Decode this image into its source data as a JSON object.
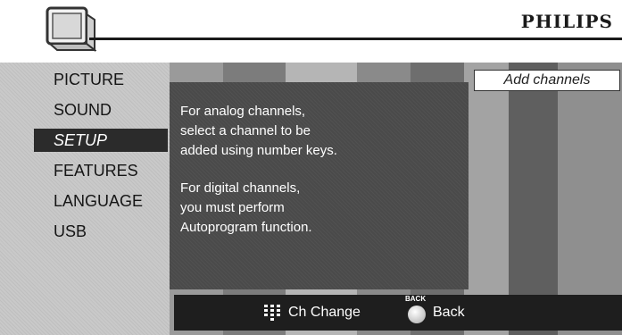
{
  "header": {
    "brand": "PHILIPS",
    "tv_icon": "tv-icon"
  },
  "menu": {
    "items": [
      {
        "label": "PICTURE",
        "selected": false
      },
      {
        "label": "SOUND",
        "selected": false
      },
      {
        "label": "SETUP",
        "selected": true
      },
      {
        "label": "FEATURES",
        "selected": false
      },
      {
        "label": "LANGUAGE",
        "selected": false
      },
      {
        "label": "USB",
        "selected": false
      }
    ]
  },
  "panel": {
    "title": "Add channels",
    "analog_lines": [
      "For analog channels,",
      "select a channel to be",
      "added using number keys."
    ],
    "digital_lines": [
      "For digital channels,",
      "you must perform",
      "Autoprogram function."
    ]
  },
  "bottom_bar": {
    "ch_change_label": "Ch Change",
    "ch_change_icon": "keypad-icon",
    "back_label": "Back",
    "back_key_text": "BACK",
    "back_icon": "back-button-icon"
  },
  "colors": {
    "menu_bg": "#c9c9c9",
    "selected_bg": "#2b2b2b",
    "panel_bg": "#4a4a4a",
    "bar_bg": "#1e1e1e"
  }
}
